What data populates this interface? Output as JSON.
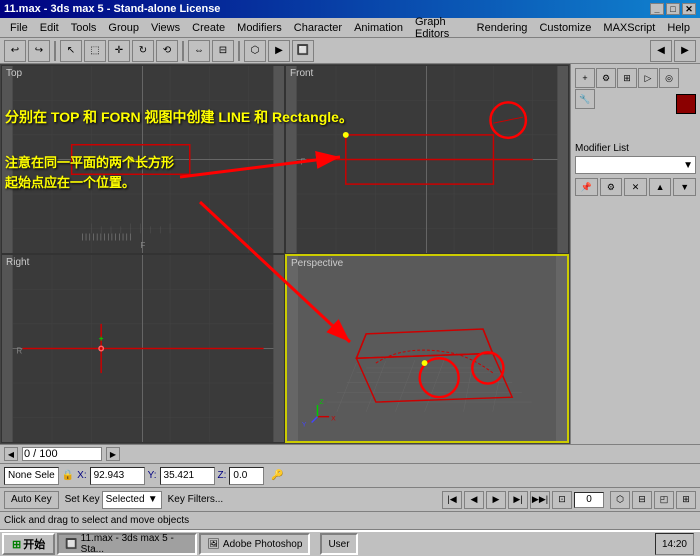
{
  "window": {
    "title": "11.max - 3ds max 5 - Stand-alone License",
    "minimize": "_",
    "maximize": "□",
    "close": "✕"
  },
  "menu": {
    "items": [
      "File",
      "Edit",
      "Tools",
      "Group",
      "Views",
      "Create",
      "Modifiers",
      "Character",
      "Animation",
      "Graph Editors",
      "Rendering",
      "Customize",
      "MAXScript",
      "Help"
    ]
  },
  "annotation": {
    "line1": "分别在 TOP 和 FORN 视图中创建 LINE 和 Rectangle。",
    "line2": "注意在同一平面的两个长方形",
    "line3": "起始点应在一个位置。"
  },
  "viewports": {
    "top_label": "Top",
    "front_label": "Front",
    "right_label": "Right",
    "perspective_label": "Perspective"
  },
  "right_panel": {
    "modifier_label": "Modifier List",
    "tabs": [
      "▶",
      "☁",
      "⬡",
      "🔧",
      "💡",
      "📷",
      "🎬"
    ]
  },
  "status": {
    "none_select": "None Sele",
    "lock": "🔒",
    "x_label": "X:",
    "x_value": "92.943",
    "y_label": "Y:",
    "y_value": "35.421",
    "z_label": "Z:",
    "z_value": "0.0",
    "progress": "0 / 100",
    "auto_key": "Auto Key",
    "selected": "Selected",
    "key_filters": "Key Filters...",
    "set_key": "Set Key",
    "frame": "0"
  },
  "help_text": "Click and drag to select and move objects",
  "taskbar": {
    "start": "开始",
    "items": [
      {
        "label": "11.max - 3ds max 5 - Sta...",
        "active": true
      },
      {
        "label": "Adobe Photoshop",
        "active": false
      }
    ],
    "user_label": "User",
    "time": "14:20"
  }
}
